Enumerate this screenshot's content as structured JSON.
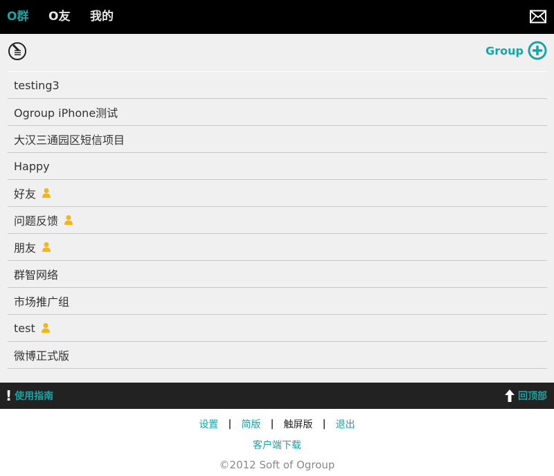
{
  "nav": {
    "tabs": [
      "O群",
      "O友",
      "我的"
    ],
    "active_tab": "O群",
    "mail_icon": "mail-icon"
  },
  "toolbar": {
    "list_icon": "note-list-icon",
    "new_group_label": "Group",
    "new_group_icon": "plus-circle-icon"
  },
  "groups": [
    {
      "name": "testing3",
      "member": false
    },
    {
      "name": "Ogroup iPhone测试",
      "member": false
    },
    {
      "name": "大汉三通园区短信项目",
      "member": false
    },
    {
      "name": "Happy",
      "member": false
    },
    {
      "name": "好友",
      "member": true
    },
    {
      "name": "问题反馈",
      "member": true
    },
    {
      "name": "朋友",
      "member": true
    },
    {
      "name": "群智网络",
      "member": false
    },
    {
      "name": "市场推广组",
      "member": false
    },
    {
      "name": "test",
      "member": true
    },
    {
      "name": "微博正式版",
      "member": false
    }
  ],
  "bottombar": {
    "guide_mark": "!",
    "guide_label": "使用指南",
    "top_label": "回顶部"
  },
  "footer": {
    "links": [
      "设置",
      "简版",
      "触屏版",
      "退出"
    ],
    "current": "触屏版",
    "separator": "|",
    "download": "客户端下载",
    "copyright": "©2012 Soft of Ogroup"
  },
  "colors": {
    "accent": "#1aa3a3",
    "person_icon": "#f2b51c",
    "topbar": "#000000",
    "bottombar": "#222222",
    "list_bg": "#f0f0f0"
  }
}
